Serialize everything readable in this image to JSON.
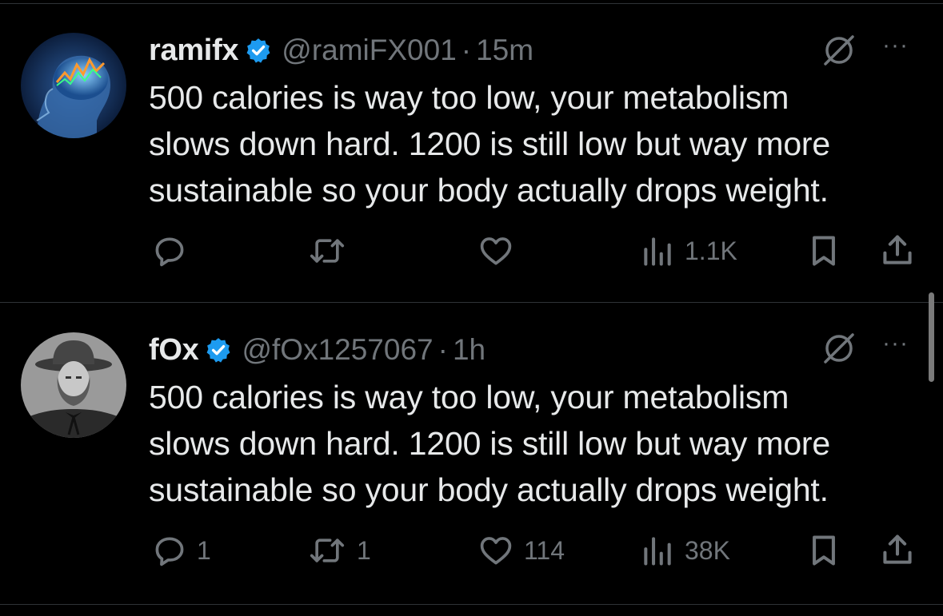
{
  "tweets": [
    {
      "name": "ramifx",
      "handle": "@ramiFX001",
      "separator": "·",
      "time": "15m",
      "lines": [
        "500 calories is way too low, your metabolism",
        "slows down hard. 1200 is still low but way more",
        "sustainable so your body actually drops weight."
      ],
      "replies": "",
      "reposts": "",
      "likes": "",
      "views": "1.1K"
    },
    {
      "name": "fOx",
      "handle": "@fOx1257067",
      "separator": "·",
      "time": "1h",
      "lines": [
        "500 calories is way too low, your metabolism",
        "slows down hard. 1200 is still low but way more",
        "sustainable so your body actually drops weight."
      ],
      "replies": "1",
      "reposts": "1",
      "likes": "114",
      "views": "38K"
    }
  ],
  "more_label": "···",
  "icons": {
    "verified": "verified-badge-icon",
    "grok": "grok-icon",
    "reply": "reply-icon",
    "repost": "repost-icon",
    "like": "like-icon",
    "views": "views-icon",
    "bookmark": "bookmark-icon",
    "share": "share-icon"
  },
  "colors": {
    "background": "#000000",
    "text": "#e7e9ea",
    "muted": "#71767b",
    "verified": "#1d9bf0",
    "divider": "#2f3336"
  }
}
